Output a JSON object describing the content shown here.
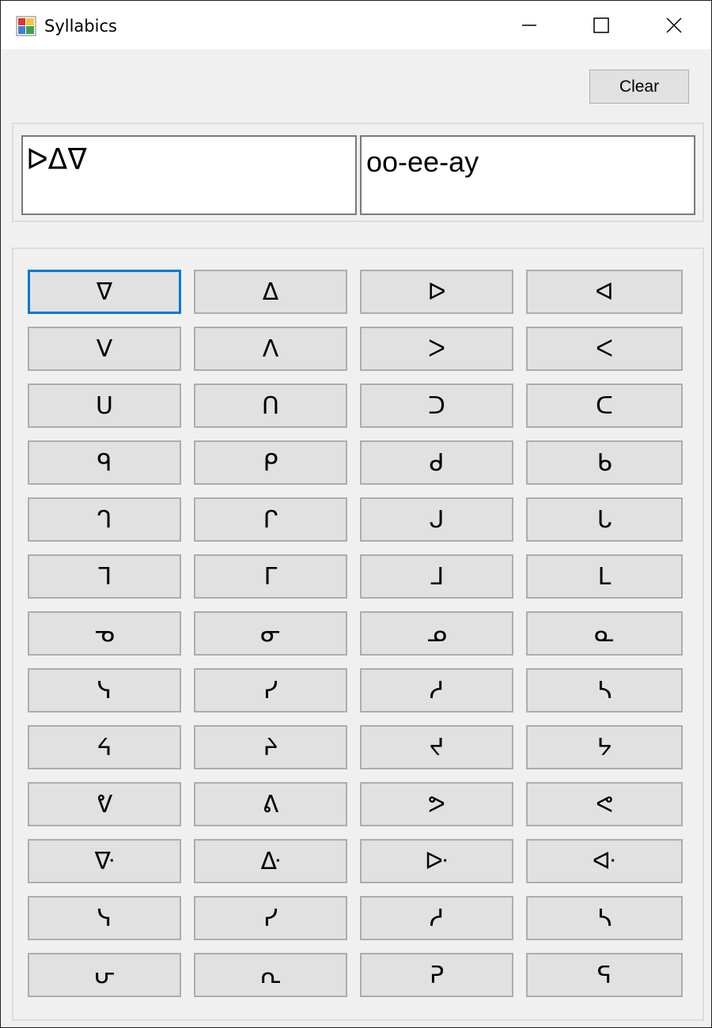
{
  "window": {
    "title": "Syllabics",
    "icon": "app-window-icon",
    "controls": [
      "minimize-icon",
      "maximize-icon",
      "close-icon"
    ]
  },
  "toolbar": {
    "clear_label": "Clear"
  },
  "output": {
    "syllabics_text": "ᐅᐃᐁ",
    "roman_text": "oo-ee-ay"
  },
  "keys": [
    "ᐁ",
    "ᐃ",
    "ᐅ",
    "ᐊ",
    "ᐯ",
    "ᐱ",
    "ᐳ",
    "ᐸ",
    "ᑌ",
    "ᑎ",
    "ᑐ",
    "ᑕ",
    "ᑫ",
    "ᑭ",
    "ᑯ",
    "ᑲ",
    "ᒉ",
    "ᒋ",
    "ᒍ",
    "ᒐ",
    "ᒣ",
    "ᒥ",
    "ᒧ",
    "ᒪ",
    "ᓀ",
    "ᓂ",
    "ᓄ",
    "ᓇ",
    "ᓭ",
    "ᓯ",
    "ᓱ",
    "ᓴ",
    "ᔦ",
    "ᔨ",
    "ᔪ",
    "ᔭ",
    "ᕓ",
    "ᕕ",
    "ᕗ",
    "ᕙ",
    "ᐍ",
    "ᐏ",
    "ᐓ",
    "ᐘ",
    "ᓭ",
    "ᓯ",
    "ᓱ",
    "ᓴ",
    "ᕂ",
    "ᕆ",
    "ᕈ",
    "ᕋ"
  ],
  "colors": {
    "window_bg": "#f0f0f0",
    "button_bg": "#e1e1e1",
    "button_border": "#adadad",
    "focus_border": "#0078d7"
  }
}
